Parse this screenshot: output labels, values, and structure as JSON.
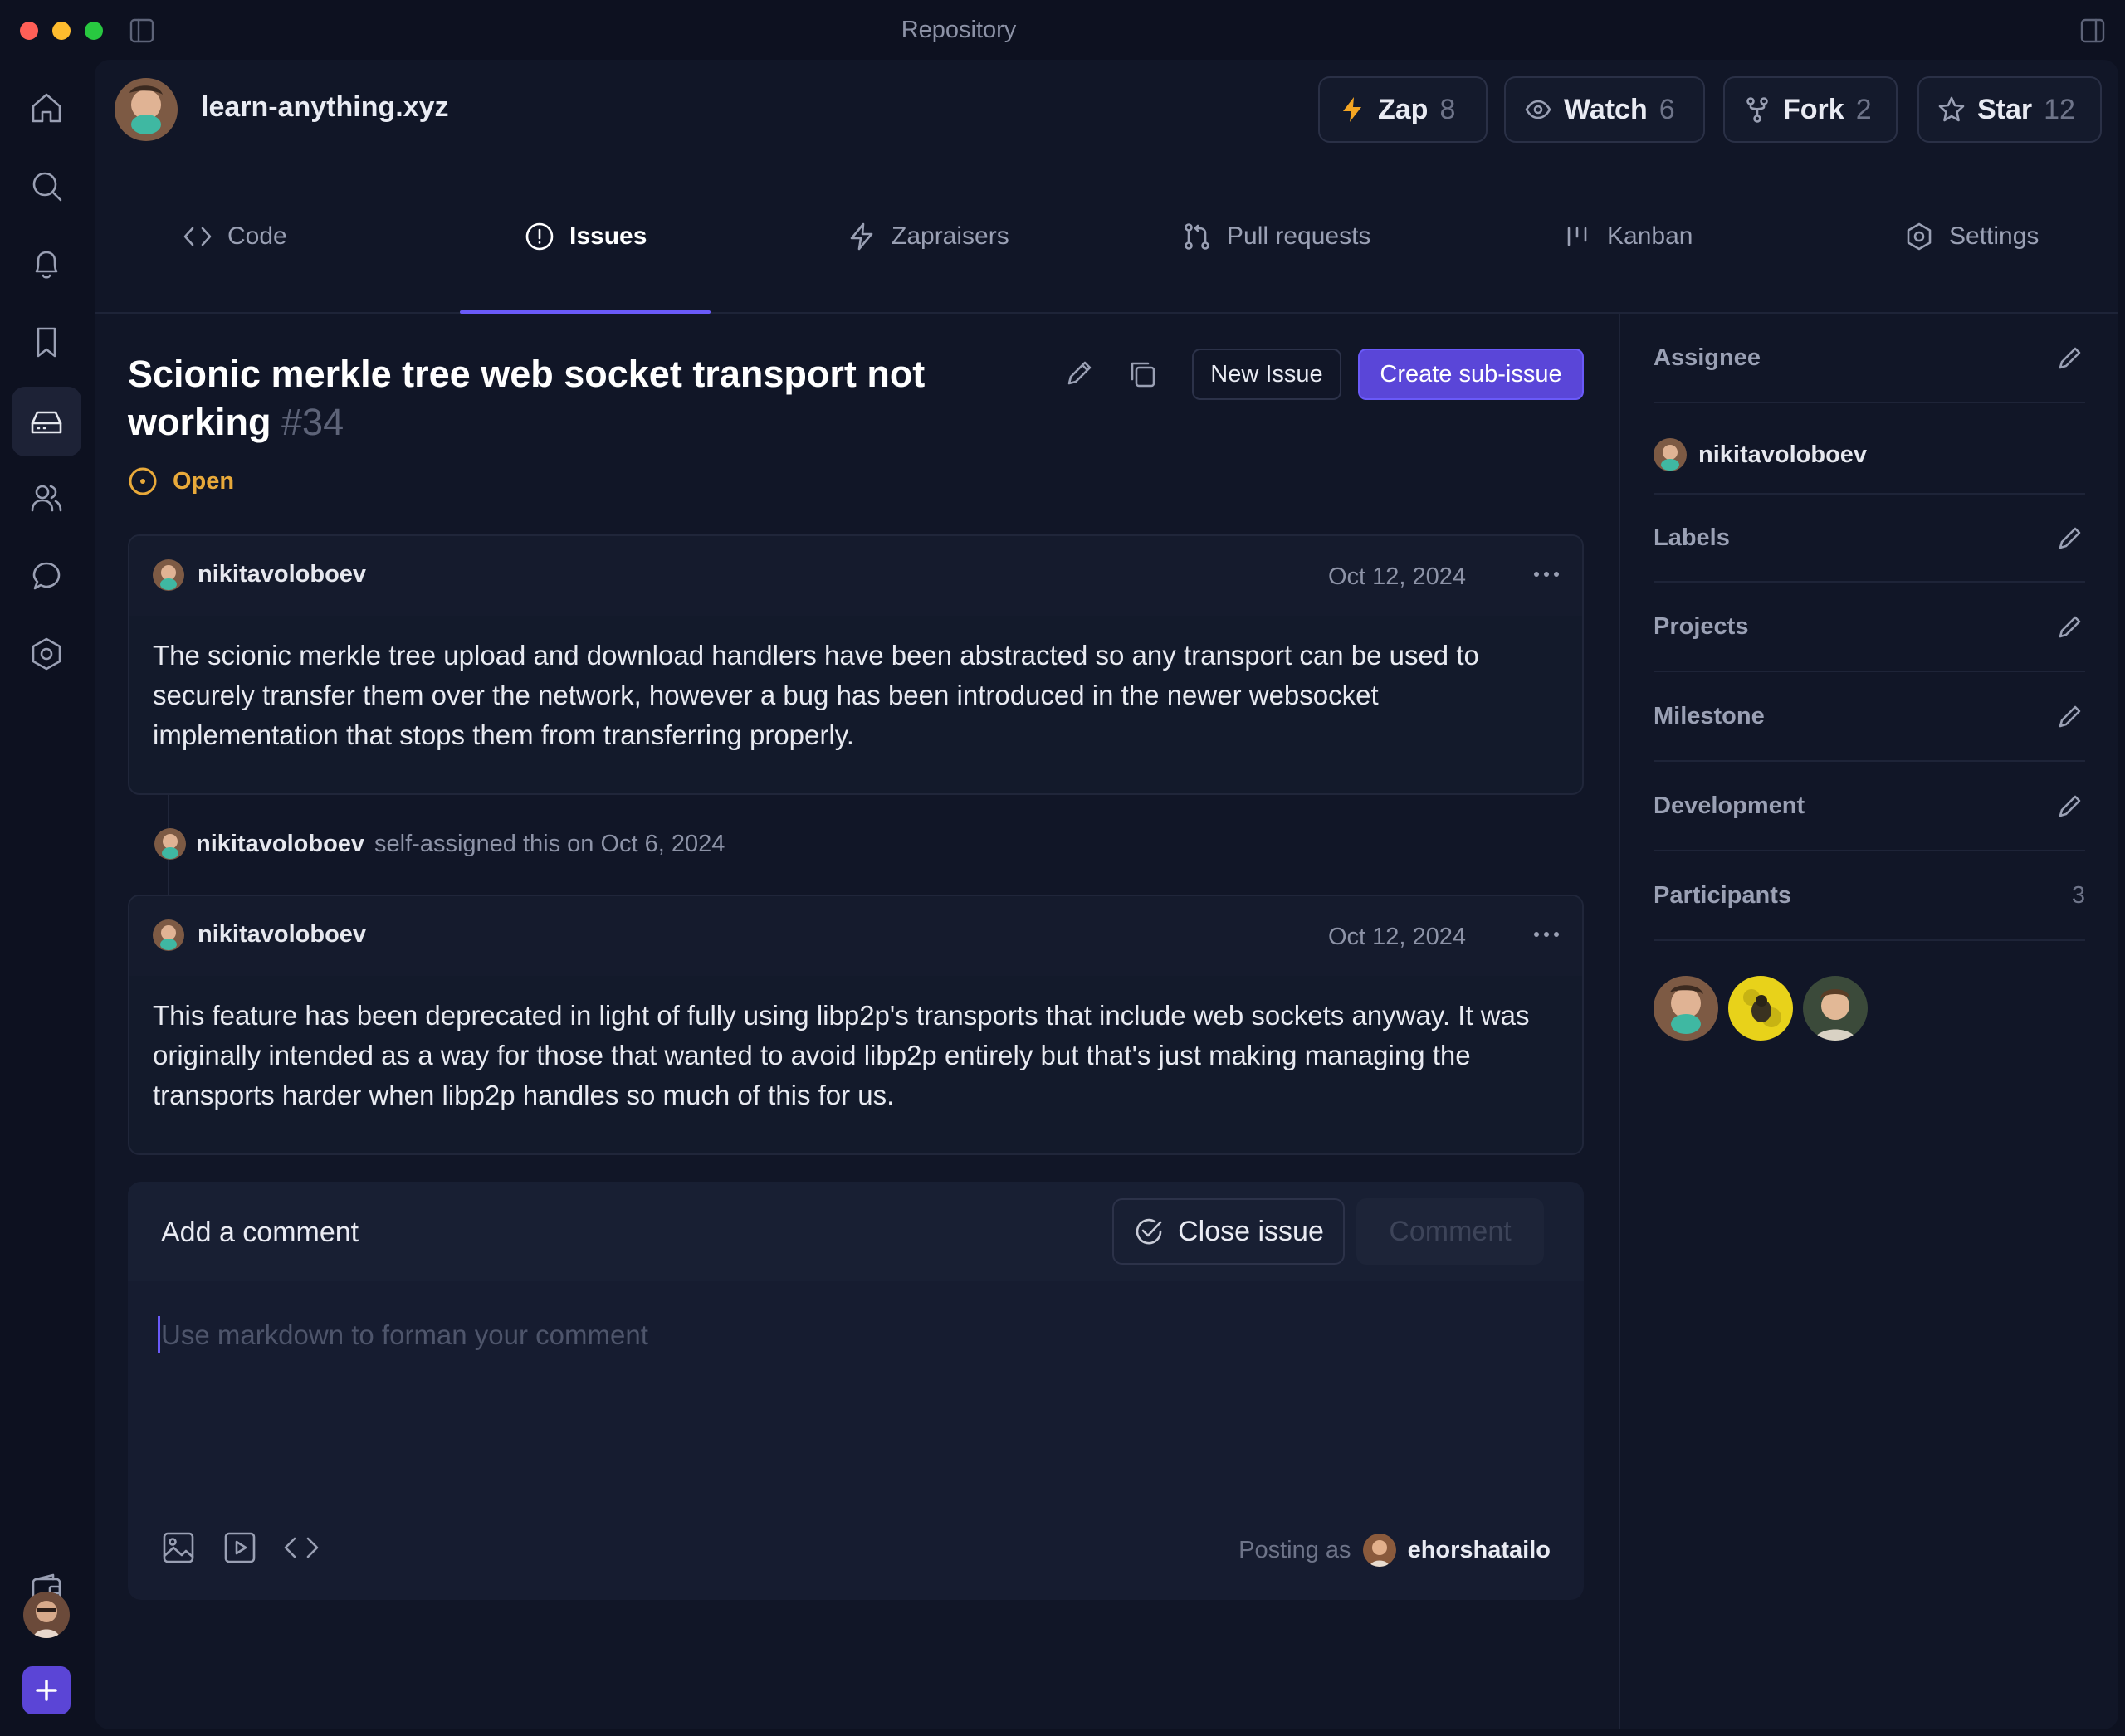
{
  "window": {
    "title": "Repository"
  },
  "repo": {
    "name": "learn-anything.xyz"
  },
  "header_buttons": {
    "zap": {
      "label": "Zap",
      "count": "8"
    },
    "watch": {
      "label": "Watch",
      "count": "6"
    },
    "fork": {
      "label": "Fork",
      "count": "2"
    },
    "star": {
      "label": "Star",
      "count": "12"
    }
  },
  "tabs": [
    {
      "label": "Code",
      "icon": "code-icon"
    },
    {
      "label": "Issues",
      "icon": "issue-icon"
    },
    {
      "label": "Zapraisers",
      "icon": "zap-icon"
    },
    {
      "label": "Pull requests",
      "icon": "pull-request-icon"
    },
    {
      "label": "Kanban",
      "icon": "kanban-icon"
    },
    {
      "label": "Settings",
      "icon": "settings-icon"
    }
  ],
  "issue": {
    "title": "Scionic merkle tree web socket transport not working",
    "number": "#34",
    "status": "Open",
    "new_issue_label": "New Issue",
    "create_sub_issue_label": "Create sub-issue"
  },
  "comments": [
    {
      "author": "nikitavoloboev",
      "date": "Oct 12, 2024",
      "body": "The scionic merkle tree upload and download handlers have been abstracted so any transport can be used to securely transfer them over the network, however a bug has been introduced in the newer websocket implementation that stops them from transferring properly."
    },
    {
      "author": "nikitavoloboev",
      "date": "Oct 12, 2024",
      "body": "This feature has been deprecated in light of fully using libp2p's transports that include web sockets anyway. It was originally intended as a way for those that wanted to avoid libp2p entirely but that's just making managing the transports harder when libp2p handles so much of this for us."
    }
  ],
  "event": {
    "author": "nikitavoloboev",
    "text": "self-assigned this on Oct 6, 2024"
  },
  "composer": {
    "title": "Add a comment",
    "close_label": "Close issue",
    "comment_label": "Comment",
    "placeholder": "Use markdown to forman your comment",
    "posting_as_label": "Posting as",
    "posting_as_user": "ehorshatailo"
  },
  "sidebar": {
    "assignee_label": "Assignee",
    "assignee": "nikitavoloboev",
    "labels_label": "Labels",
    "projects_label": "Projects",
    "milestone_label": "Milestone",
    "development_label": "Development",
    "participants_label": "Participants",
    "participants_count": "3"
  },
  "colors": {
    "accent": "#6a5af9",
    "open_status": "#e8a93a",
    "zap": "#f5a623"
  }
}
